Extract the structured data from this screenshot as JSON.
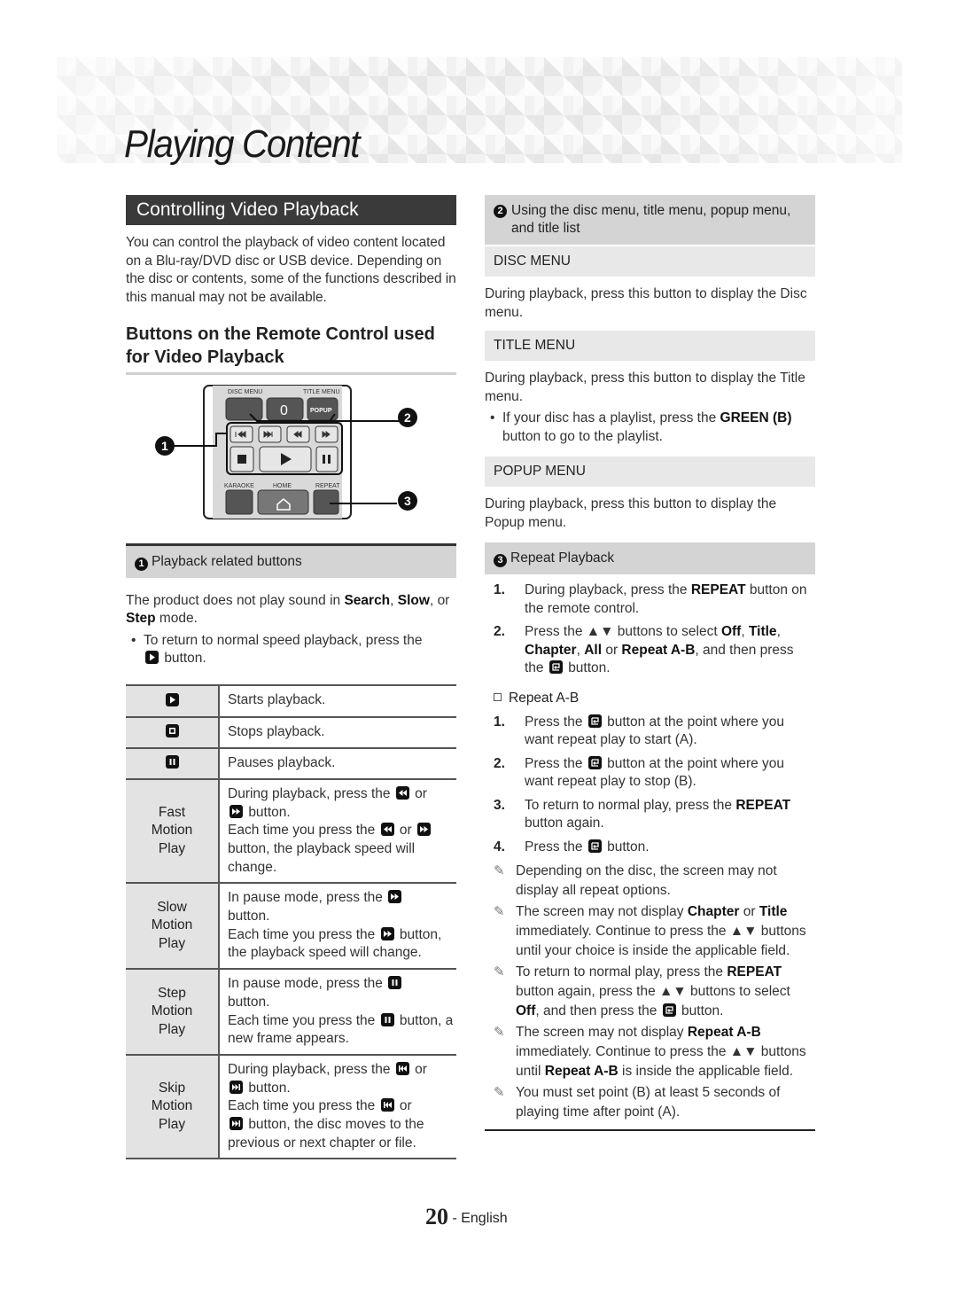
{
  "header": {
    "title": "Playing Content"
  },
  "left": {
    "section_title": "Controlling Video Playback",
    "intro": "You can control the playback of video content located on a Blu-ray/DVD disc or USB device. Depending on the disc or contents, some of the functions described in this manual may not be available.",
    "subheading": "Buttons on the Remote Control used for Video Playback",
    "remote": {
      "labels": {
        "disc_menu": "DISC MENU",
        "title_menu": "TITLE MENU",
        "zero": "0",
        "popup": "POPUP",
        "karaoke": "KARAOKE",
        "home": "HOME",
        "repeat": "REPEAT"
      },
      "callouts": [
        "1",
        "2",
        "3"
      ]
    },
    "playback_section": {
      "badge": "1",
      "title": "Playback related buttons",
      "note_pre": "The product does not play sound in ",
      "note_b1": "Search",
      "note_mid1": ", ",
      "note_b2": "Slow",
      "note_mid2": ", or ",
      "note_b3": "Step",
      "note_post": " mode.",
      "bullet_pre": "To return to normal speed playback, press the",
      "bullet_post": "button."
    },
    "table": {
      "rows": [
        {
          "key_icon": "play-icon",
          "desc": "Starts playback."
        },
        {
          "key_icon": "stop-icon",
          "desc": "Stops playback."
        },
        {
          "key_icon": "pause-icon",
          "desc": "Pauses playback."
        },
        {
          "key": [
            "Fast",
            "Motion",
            "Play"
          ],
          "lines": [
            "During playback, press the",
            "or",
            "button.",
            "Each time you press the",
            "or",
            "button, the playback speed will change."
          ]
        },
        {
          "key": [
            "Slow",
            "Motion",
            "Play"
          ],
          "lines": [
            "In pause mode, press the",
            "button.",
            "Each time you press the",
            "button, the playback speed will change."
          ]
        },
        {
          "key": [
            "Step",
            "Motion",
            "Play"
          ],
          "lines": [
            "In pause mode, press the",
            "button.",
            "Each time you press the",
            "button, a new frame appears."
          ]
        },
        {
          "key": [
            "Skip",
            "Motion",
            "Play"
          ],
          "lines": [
            "During playback, press the",
            "or",
            "button.",
            "Each time you press the",
            "or",
            "button, the disc moves to the previous or next chapter or file."
          ]
        }
      ]
    }
  },
  "right": {
    "menu_section": {
      "badge": "2",
      "title": "Using the disc menu, title menu, popup menu, and title list"
    },
    "disc_menu": {
      "title": "DISC MENU",
      "desc": "During playback, press this button to display the Disc menu."
    },
    "title_menu": {
      "title": "TITLE MENU",
      "desc": "During playback, press this button to display the Title menu.",
      "bullet_pre": "If your disc has a playlist, press the ",
      "bullet_b": "GREEN (B)",
      "bullet_post": " button to go to the playlist."
    },
    "popup_menu": {
      "title": "POPUP MENU",
      "desc": "During playback, press this button to display the Popup menu."
    },
    "repeat_section": {
      "badge": "3",
      "title": "Repeat Playback",
      "steps": [
        {
          "n": "1.",
          "pre": "During playback, press the ",
          "b": "REPEAT",
          "post": " button on the remote control."
        },
        {
          "n": "2.",
          "t1": "Press the ▲▼ buttons to select ",
          "b1": "Off",
          "t2": ", ",
          "b2": "Title",
          "t3": ", ",
          "b3": "Chapter",
          "t4": ", ",
          "b4": "All",
          "t5": " or ",
          "b5": "Repeat A-B",
          "t6": ", and then press the",
          "t7": "button."
        }
      ],
      "ab_title": "Repeat A-B",
      "ab_steps": [
        {
          "n": "1.",
          "pre": "Press the",
          "post": "button at the point where you want repeat play to start (A)."
        },
        {
          "n": "2.",
          "pre": "Press the",
          "post": "button at the point where you want repeat play to stop (B)."
        },
        {
          "n": "3.",
          "pre": "To return to normal play, press the ",
          "b": "REPEAT",
          "post": " button again."
        },
        {
          "n": "4.",
          "pre": "Press the",
          "post": "button."
        }
      ],
      "notes": [
        {
          "text": "Depending on the disc, the screen may not display all repeat options."
        },
        {
          "t1": "The screen may not display ",
          "b1": "Chapter",
          "t2": " or ",
          "b2": "Title",
          "t3": " immediately. Continue to press the ▲▼ buttons until your choice is inside the applicable field."
        },
        {
          "t1": "To return to normal play, press the ",
          "b1": "REPEAT",
          "t2": " button again, press the ▲▼ buttons to select ",
          "b2": "Off",
          "t3": ", and then press the",
          "t4": "button."
        },
        {
          "t1": "The screen may not display ",
          "b1": "Repeat A-B",
          "t2": " immediately. Continue to press the ▲▼ buttons until ",
          "b2": "Repeat A-B",
          "t3": " is inside the applicable field."
        },
        {
          "text": "You must set point (B) at least 5 seconds of playing time after point (A)."
        }
      ]
    }
  },
  "footer": {
    "page_number": "20",
    "language": "- English"
  }
}
